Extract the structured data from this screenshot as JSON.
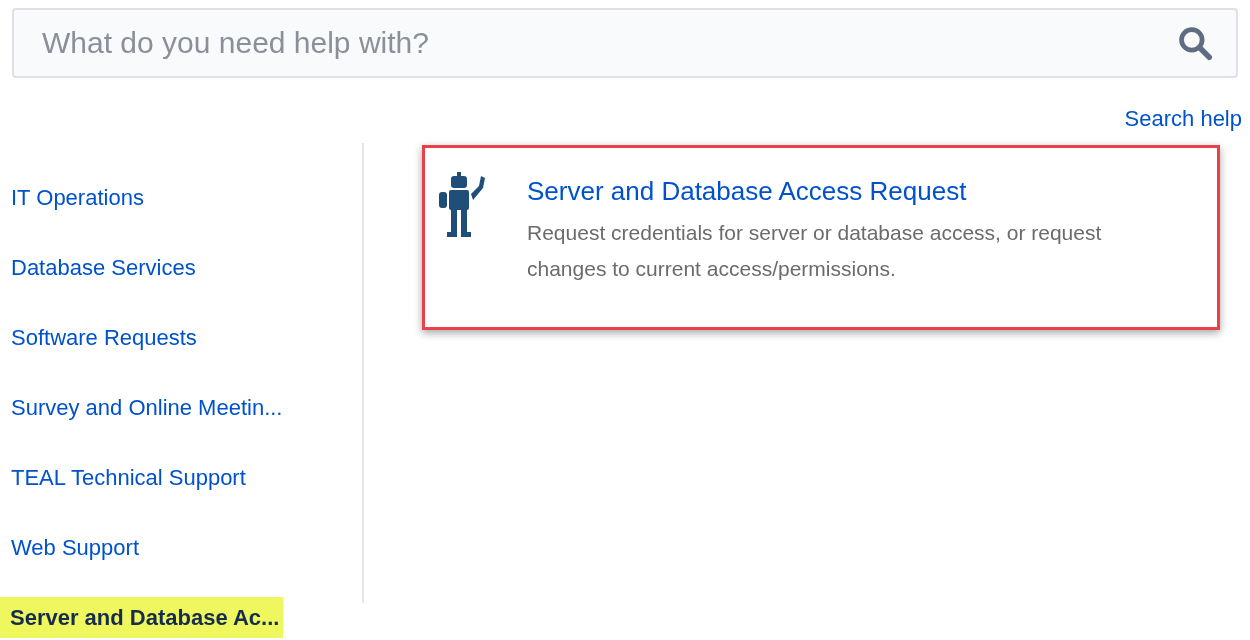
{
  "search": {
    "placeholder": "What do you need help with?"
  },
  "search_help_link": "Search help",
  "sidebar": {
    "items": [
      {
        "label": "IT Operations",
        "selected": false
      },
      {
        "label": "Database Services",
        "selected": false
      },
      {
        "label": "Software Requests",
        "selected": false
      },
      {
        "label": "Survey and Online Meetin...",
        "selected": false
      },
      {
        "label": "TEAL Technical Support",
        "selected": false
      },
      {
        "label": "Web Support",
        "selected": false
      },
      {
        "label": "Server and Database Ac...",
        "selected": true
      }
    ]
  },
  "request_types": [
    {
      "title": "Server and Database Access Request",
      "description": "Request credentials for server or database access, or request changes to current access/permissions.",
      "highlighted": true
    }
  ]
}
